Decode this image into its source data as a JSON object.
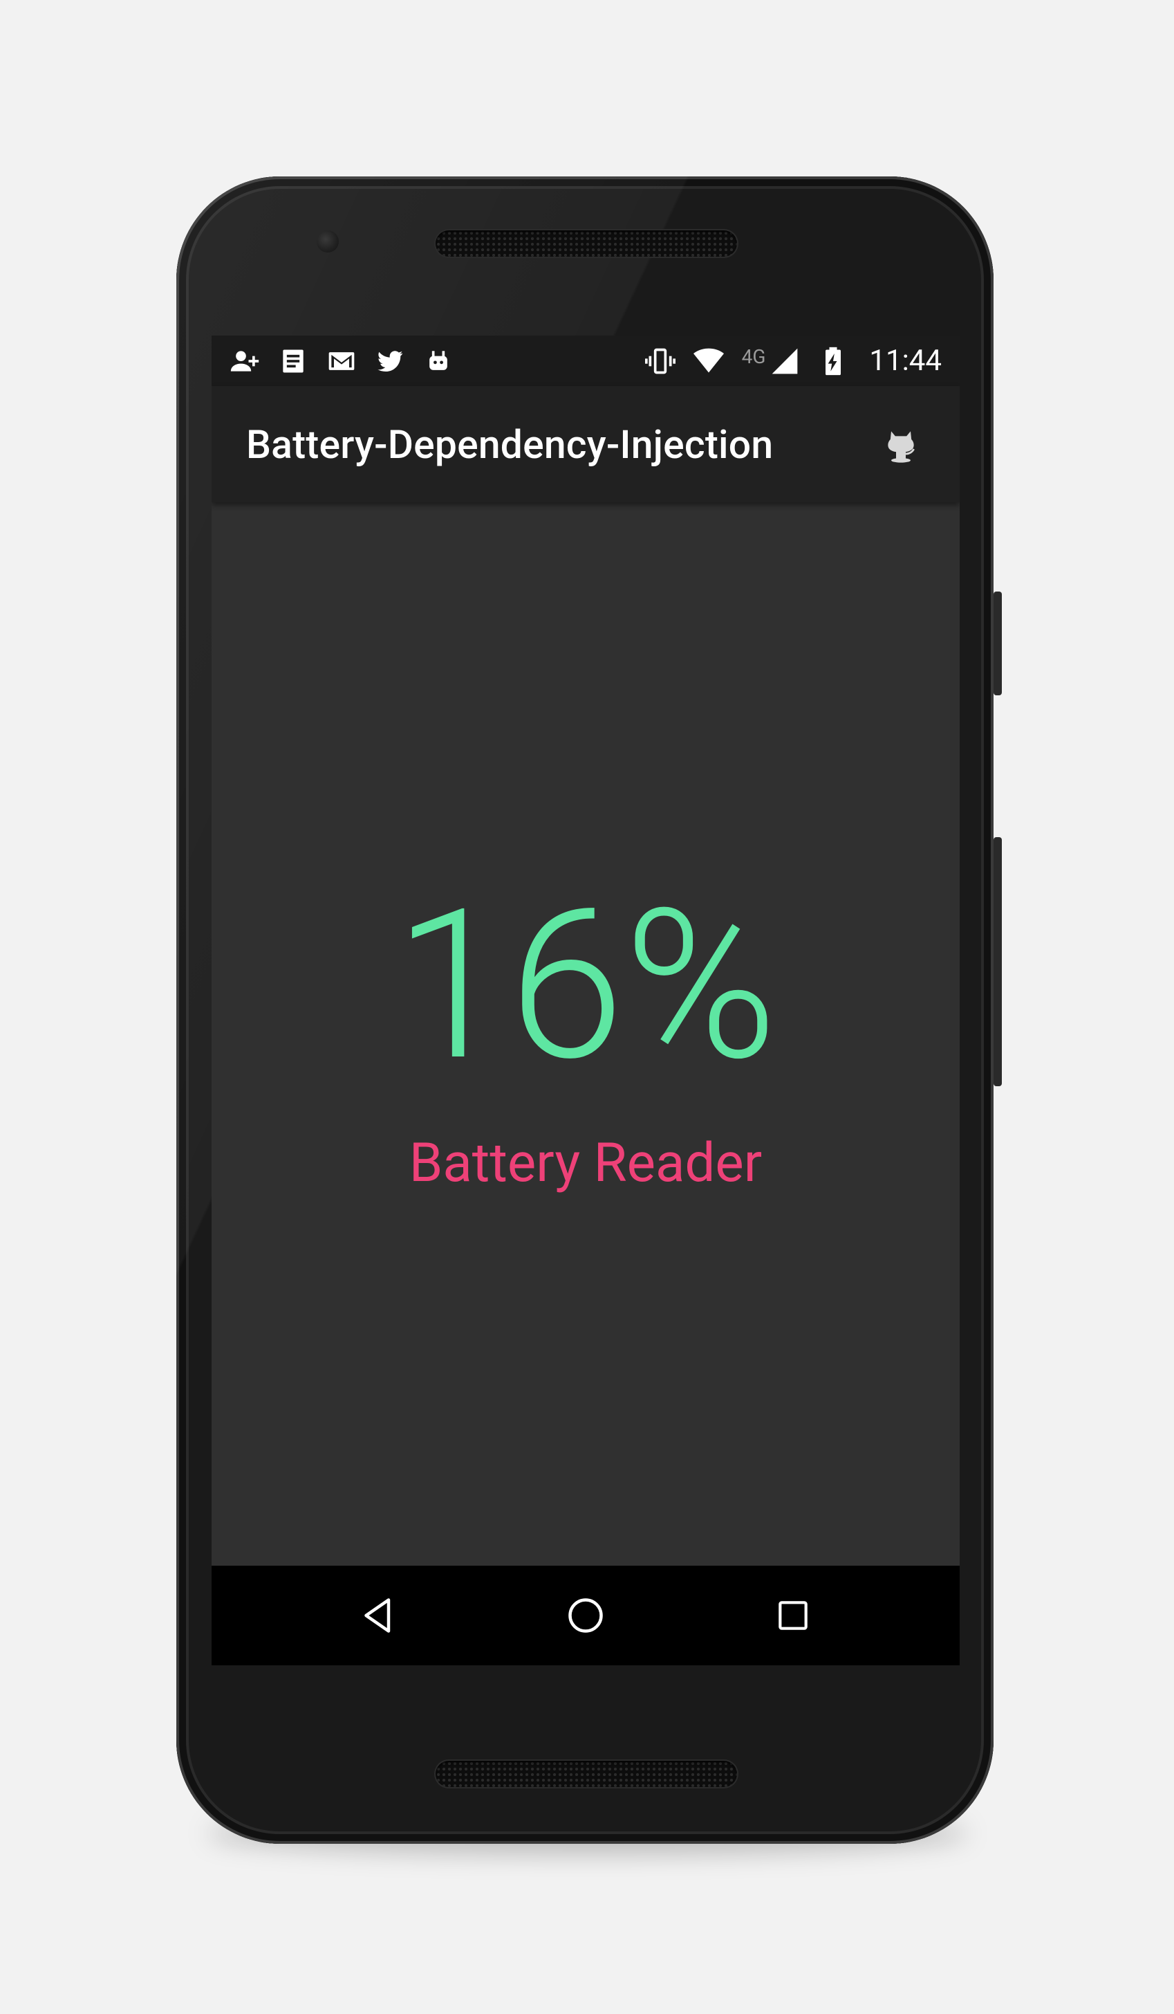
{
  "status_bar": {
    "left_icons": [
      "add-contact-icon",
      "notes-icon",
      "gmail-icon",
      "twitter-icon",
      "android-icon"
    ],
    "right_icons": [
      "vibrate-icon",
      "wifi-icon",
      "cell-signal-icon",
      "battery-charging-icon"
    ],
    "network": "4G",
    "time": "11:44"
  },
  "toolbar": {
    "title": "Battery-Dependency-Injection",
    "action_icon": "github-octocat-icon"
  },
  "main": {
    "battery_percent": "16%",
    "label": "Battery Reader"
  },
  "navigation": {
    "buttons": [
      "back-icon",
      "home-icon",
      "recents-icon"
    ]
  },
  "colors": {
    "percent": "#5ee6a2",
    "label": "#ee4178",
    "screen_bg": "#303030",
    "toolbar_bg": "#212121",
    "statusbar_bg": "#1b1b1b",
    "navbar_bg": "#000000"
  }
}
